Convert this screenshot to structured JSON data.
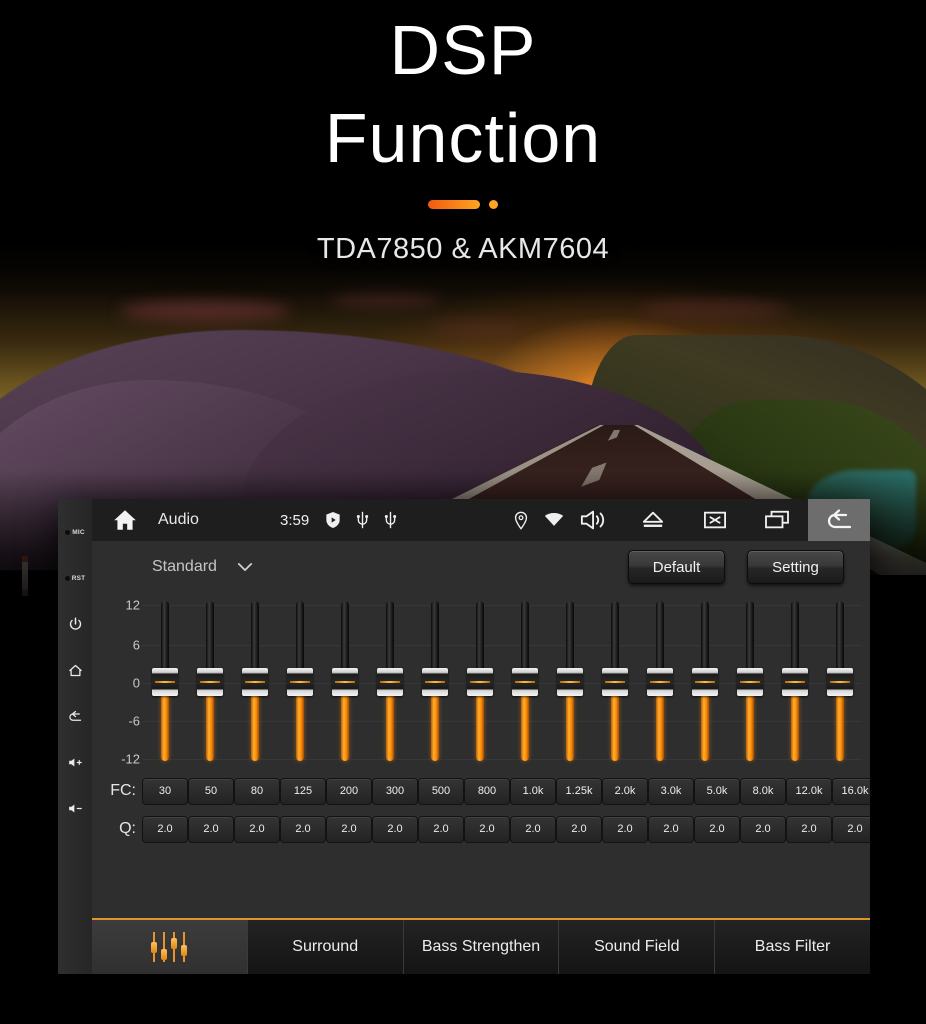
{
  "headline": {
    "line1": "DSP",
    "line2": "Function",
    "subtitle": "TDA7850 & AKM7604"
  },
  "colors": {
    "accent_orange": "#e8932b",
    "slider_orange": "#ff8c08",
    "tab_active_bg": "#3c3c3c",
    "screen_bg": "#2e2e2e",
    "statusbar_bg": "#1e1e1e"
  },
  "device": {
    "bezel": {
      "leds": [
        {
          "name": "mic-led",
          "label": "MIC"
        },
        {
          "name": "rst-led",
          "label": "RST"
        }
      ],
      "buttons": [
        {
          "name": "power-button",
          "icon": "power-icon"
        },
        {
          "name": "home-button",
          "icon": "home-icon"
        },
        {
          "name": "back-button",
          "icon": "back-icon"
        },
        {
          "name": "volume-up-button",
          "icon": "volume-up-icon"
        },
        {
          "name": "volume-down-button",
          "icon": "volume-down-icon"
        }
      ]
    },
    "statusbar": {
      "home_icon": "home-icon",
      "title": "Audio",
      "time": "3:59",
      "mini_icons": [
        "shield-play-icon",
        "usb-icon",
        "usb-icon"
      ],
      "right_icons": [
        "location-pin-icon",
        "wifi-icon",
        "volume-icon"
      ],
      "buttons": [
        {
          "name": "eject-button",
          "icon": "eject-icon",
          "active": false
        },
        {
          "name": "close-button",
          "icon": "close-box-icon",
          "active": false
        },
        {
          "name": "recents-button",
          "icon": "recents-icon",
          "active": false
        },
        {
          "name": "back-nav-button",
          "icon": "back-arrow-icon",
          "active": true
        }
      ]
    },
    "eq": {
      "preset_label": "Standard",
      "preset_chevron": "chevron-down-icon",
      "default_button": "Default",
      "setting_button": "Setting",
      "scale_labels": [
        "12",
        "6",
        "0",
        "-6",
        "-12"
      ],
      "fc_label": "FC:",
      "q_label": "Q:",
      "bands": [
        {
          "fc": "30",
          "q": "2.0",
          "gain": 0
        },
        {
          "fc": "50",
          "q": "2.0",
          "gain": 0
        },
        {
          "fc": "80",
          "q": "2.0",
          "gain": 0
        },
        {
          "fc": "125",
          "q": "2.0",
          "gain": 0
        },
        {
          "fc": "200",
          "q": "2.0",
          "gain": 0
        },
        {
          "fc": "300",
          "q": "2.0",
          "gain": 0
        },
        {
          "fc": "500",
          "q": "2.0",
          "gain": 0
        },
        {
          "fc": "800",
          "q": "2.0",
          "gain": 0
        },
        {
          "fc": "1.0k",
          "q": "2.0",
          "gain": 0
        },
        {
          "fc": "1.25k",
          "q": "2.0",
          "gain": 0
        },
        {
          "fc": "2.0k",
          "q": "2.0",
          "gain": 0
        },
        {
          "fc": "3.0k",
          "q": "2.0",
          "gain": 0
        },
        {
          "fc": "5.0k",
          "q": "2.0",
          "gain": 0
        },
        {
          "fc": "8.0k",
          "q": "2.0",
          "gain": 0
        },
        {
          "fc": "12.0k",
          "q": "2.0",
          "gain": 0
        },
        {
          "fc": "16.0k",
          "q": "2.0",
          "gain": 0
        }
      ]
    },
    "tabs": [
      {
        "name": "tab-equalizer",
        "label": "",
        "icon": "equalizer-icon",
        "active": true
      },
      {
        "name": "tab-surround",
        "label": "Surround",
        "icon": "",
        "active": false
      },
      {
        "name": "tab-bass-strengthen",
        "label": "Bass Strengthen",
        "icon": "",
        "active": false
      },
      {
        "name": "tab-sound-field",
        "label": "Sound Field",
        "icon": "",
        "active": false
      },
      {
        "name": "tab-bass-filter",
        "label": "Bass Filter",
        "icon": "",
        "active": false
      }
    ]
  }
}
